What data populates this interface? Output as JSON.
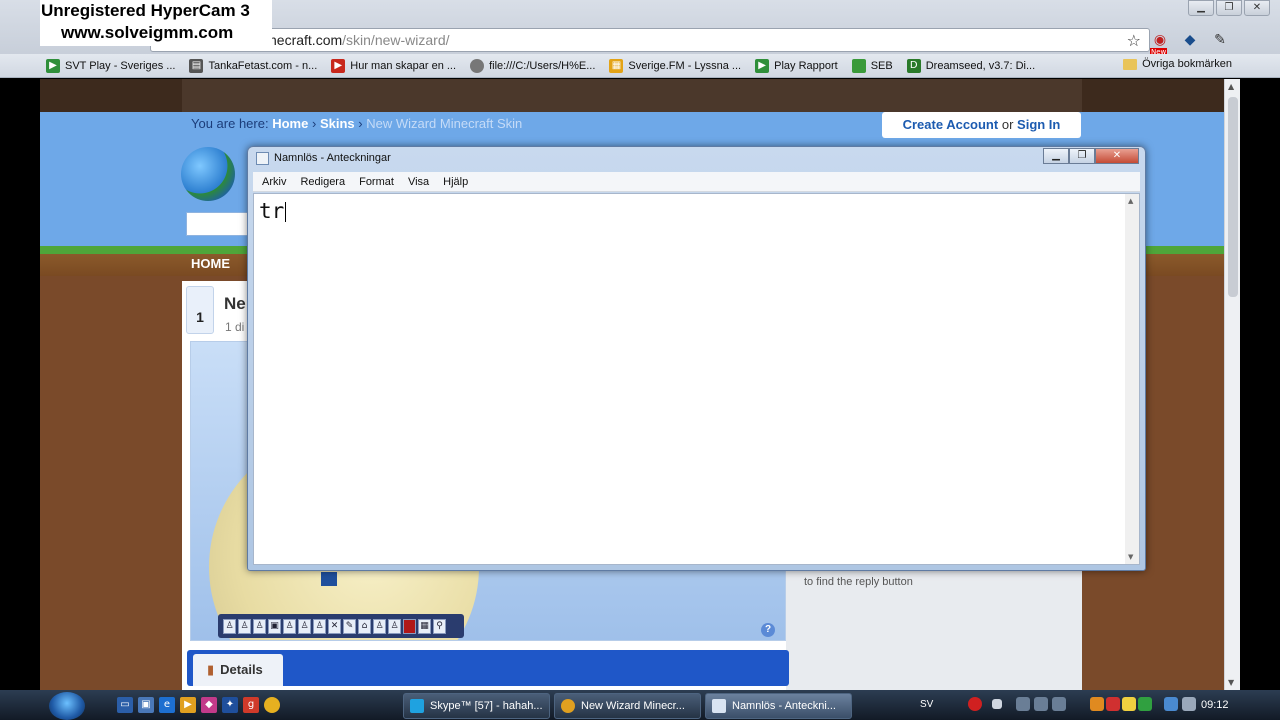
{
  "watermark": {
    "line1": "Unregistered HyperCam 3",
    "line2": "www.solveigmm.com"
  },
  "browser": {
    "window_buttons": [
      "▁",
      "❐",
      "✕"
    ],
    "address": {
      "host": "necraft.com",
      "path": "/skin/new-wizard/"
    },
    "bookmarks": [
      {
        "label": "SVT Play - Sveriges ...",
        "color": "#2f8f3a"
      },
      {
        "label": "TankaFetast.com - n...",
        "color": "#555555"
      },
      {
        "label": "Hur man skapar en ...",
        "color": "#c8281c"
      },
      {
        "label": "file:///C:/Users/H%E...",
        "color": "#777777"
      },
      {
        "label": "Sverige.FM - Lyssna ...",
        "color": "#e3a316"
      },
      {
        "label": "Play Rapport",
        "color": "#2f8f3a"
      },
      {
        "label": "SEB",
        "color": "#3a9a3a"
      },
      {
        "label": "Dreamseed, v3.7: Di...",
        "color": "#2a7a2a"
      }
    ],
    "other_bookmarks": "Övriga bokmärken"
  },
  "site": {
    "breadcrumb": {
      "prefix": "You are here:",
      "home": "Home",
      "sep1": "›",
      "skins": "Skins",
      "sep2": "›",
      "current": "New Wizard Minecraft Skin"
    },
    "account": {
      "create": "Create Account",
      "or": "or",
      "signin": "Sign In"
    },
    "nav_home": "HOME",
    "vote_count": "1",
    "skin_title": "Ne",
    "skin_sub": "1 di",
    "reply_text": "to find the reply button",
    "details_tab": "Details",
    "help_label": "?"
  },
  "notepad": {
    "title": "Namnlös - Anteckningar",
    "buttons": [
      "▁",
      "❐",
      "✕"
    ],
    "menu": [
      "Arkiv",
      "Redigera",
      "Format",
      "Visa",
      "Hjälp"
    ],
    "content": "tr"
  },
  "taskbar": {
    "tasks": [
      {
        "label": "Skype™ [57] - hahah...",
        "color": "#1fa2e0"
      },
      {
        "label": "New Wizard Minecr...",
        "color": "#e0a020"
      },
      {
        "label": "Namnlös - Anteckni...",
        "color": "#d9e4f2"
      }
    ],
    "language": "SV",
    "clock": "09:12"
  }
}
